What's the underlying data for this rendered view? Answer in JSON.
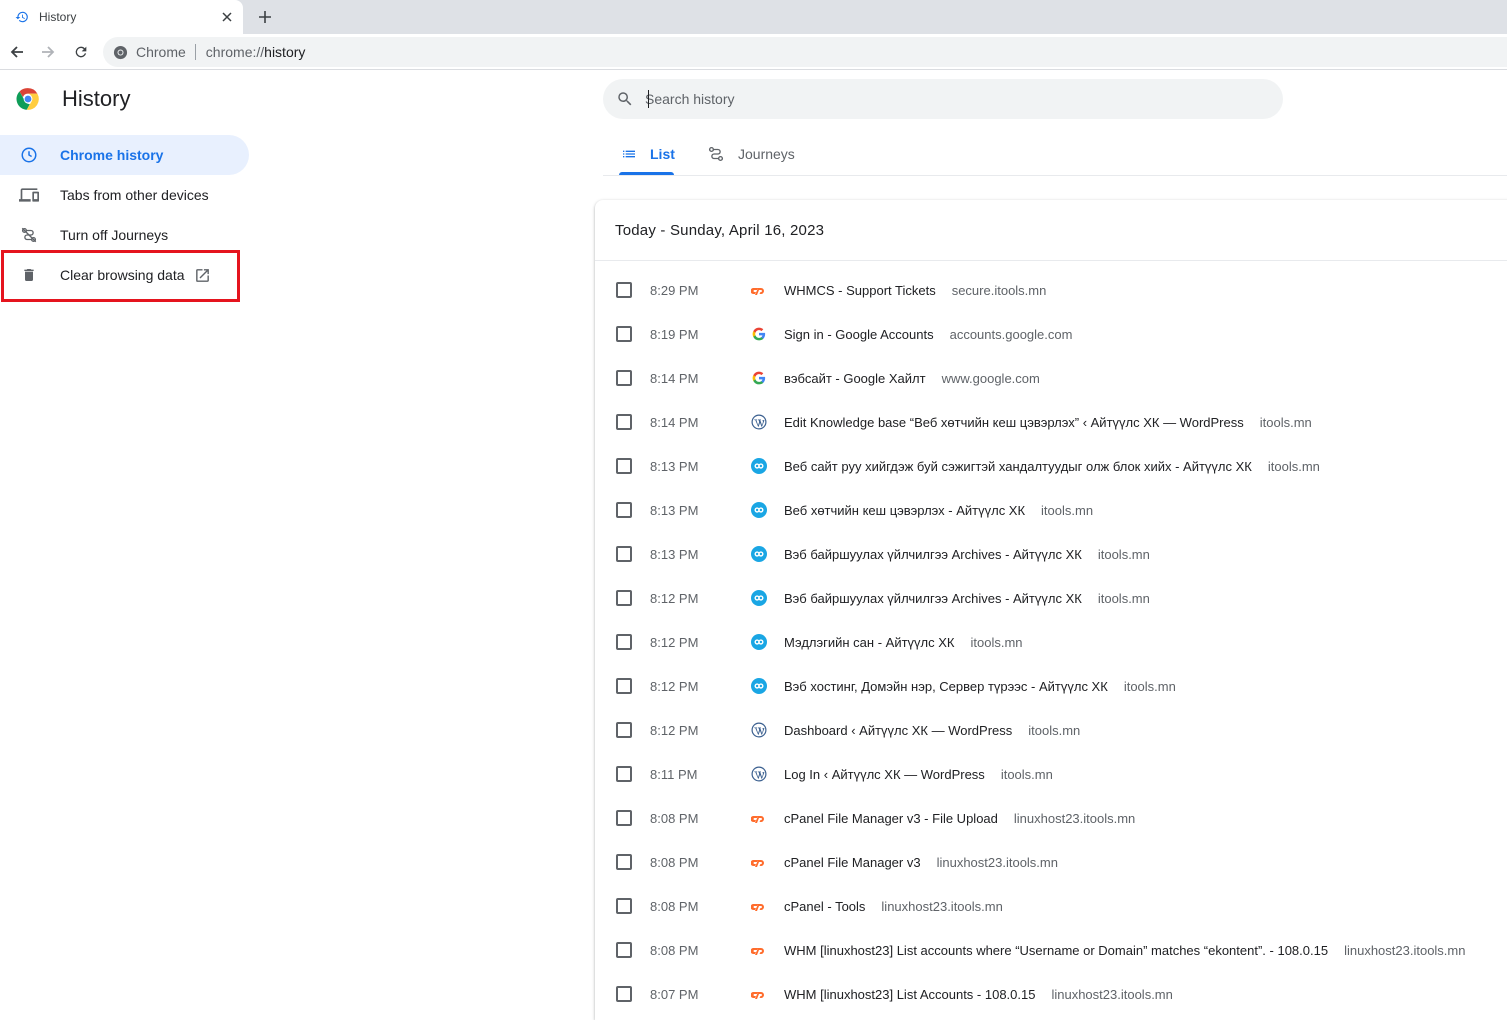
{
  "tab": {
    "title": "History"
  },
  "omnibox": {
    "chip": "Chrome",
    "url_scheme": "chrome://",
    "url_path": "history"
  },
  "app": {
    "title": "History"
  },
  "sidebar": {
    "items": [
      {
        "label": "Chrome history",
        "icon": "clock-icon",
        "selected": true
      },
      {
        "label": "Tabs from other devices",
        "icon": "devices-icon"
      },
      {
        "label": "Turn off Journeys",
        "icon": "journeys-off-icon"
      },
      {
        "label": "Clear browsing data",
        "icon": "trash-icon"
      }
    ]
  },
  "search": {
    "placeholder": "Search history"
  },
  "view_tabs": [
    {
      "label": "List",
      "icon": "list-icon",
      "active": true
    },
    {
      "label": "Journeys",
      "icon": "journeys-icon"
    }
  ],
  "day": {
    "title": "Today - Sunday, April 16, 2023"
  },
  "entries": [
    {
      "time": "8:29 PM",
      "favicon": "cpanel-icon",
      "title": "WHMCS - Support Tickets",
      "domain": "secure.itools.mn"
    },
    {
      "time": "8:19 PM",
      "favicon": "google-icon",
      "title": "Sign in - Google Accounts",
      "domain": "accounts.google.com"
    },
    {
      "time": "8:14 PM",
      "favicon": "google-icon",
      "title": "вэбсайт - Google Хайлт",
      "domain": "www.google.com"
    },
    {
      "time": "8:14 PM",
      "favicon": "wordpress-icon",
      "title": "Edit Knowledge base “Веб хөтчийн кеш цэвэрлэх” ‹ Айтүүлс ХК — WordPress",
      "domain": "itools.mn"
    },
    {
      "time": "8:13 PM",
      "favicon": "itools-icon",
      "title": "Веб сайт руу хийгдэж буй сэжигтэй хандалтуудыг олж блок хийх - Айтүүлс ХК",
      "domain": "itools.mn"
    },
    {
      "time": "8:13 PM",
      "favicon": "itools-icon",
      "title": "Веб хөтчийн кеш цэвэрлэх - Айтүүлс ХК",
      "domain": "itools.mn"
    },
    {
      "time": "8:13 PM",
      "favicon": "itools-icon",
      "title": "Вэб байршуулах үйлчилгээ Archives - Айтүүлс ХК",
      "domain": "itools.mn"
    },
    {
      "time": "8:12 PM",
      "favicon": "itools-icon",
      "title": "Вэб байршуулах үйлчилгээ Archives - Айтүүлс ХК",
      "domain": "itools.mn"
    },
    {
      "time": "8:12 PM",
      "favicon": "itools-icon",
      "title": "Мэдлэгийн сан - Айтүүлс ХК",
      "domain": "itools.mn"
    },
    {
      "time": "8:12 PM",
      "favicon": "itools-icon",
      "title": "Вэб хостинг, Домэйн нэр, Сервер түрээс - Айтүүлс ХК",
      "domain": "itools.mn"
    },
    {
      "time": "8:12 PM",
      "favicon": "wordpress-icon",
      "title": "Dashboard ‹ Айтүүлс ХК — WordPress",
      "domain": "itools.mn"
    },
    {
      "time": "8:11 PM",
      "favicon": "wordpress-icon",
      "title": "Log In ‹ Айтүүлс ХК — WordPress",
      "domain": "itools.mn"
    },
    {
      "time": "8:08 PM",
      "favicon": "cpanel-icon",
      "title": "cPanel File Manager v3 - File Upload",
      "domain": "linuxhost23.itools.mn"
    },
    {
      "time": "8:08 PM",
      "favicon": "cpanel-icon",
      "title": "cPanel File Manager v3",
      "domain": "linuxhost23.itools.mn"
    },
    {
      "time": "8:08 PM",
      "favicon": "cpanel-icon",
      "title": "cPanel - Tools",
      "domain": "linuxhost23.itools.mn"
    },
    {
      "time": "8:08 PM",
      "favicon": "cpanel-icon",
      "title": "WHM [linuxhost23] List accounts where “Username or Domain” matches “ekontent”. - 108.0.15",
      "domain": "linuxhost23.itools.mn"
    },
    {
      "time": "8:07 PM",
      "favicon": "cpanel-icon",
      "title": "WHM [linuxhost23] List Accounts - 108.0.15",
      "domain": "linuxhost23.itools.mn"
    }
  ],
  "colors": {
    "accent": "#1a73e8",
    "highlight": "#e5141e",
    "cpanel": "#ff6c2c",
    "itools": "#1aa6e4"
  }
}
